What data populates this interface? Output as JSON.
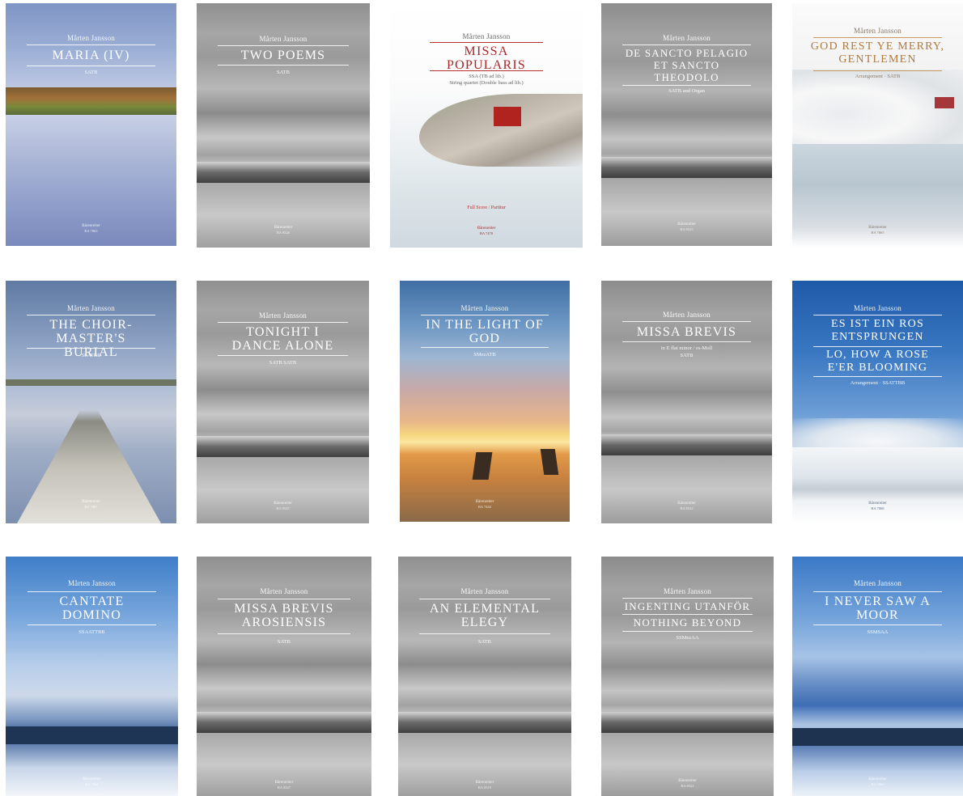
{
  "covers": [
    {
      "author": "Mårten Jansson",
      "title": "MARIA (IV)",
      "voicing": "SATB",
      "publisher": "Bärenreiter",
      "number": "BA 7863"
    },
    {
      "author": "Mårten Jansson",
      "title": "TWO POEMS",
      "voicing": "SATB",
      "publisher": "Bärenreiter",
      "number": "BA 8526"
    },
    {
      "author": "Mårten Jansson",
      "title": "MISSA POPULARIS",
      "voicing": "SSA (TB ad lib.)",
      "voicing2": "String quartet (Double bass ad lib.)",
      "edition": "Full Score / Partitur",
      "publisher": "Bärenreiter",
      "number": "BA 7470"
    },
    {
      "author": "Mårten Jansson",
      "title": "DE SANCTO PELAGIO ET SANCTO THEODOLO",
      "voicing": "SATB and Organ",
      "publisher": "Bärenreiter",
      "number": "BA 8523"
    },
    {
      "author": "Mårten Jansson",
      "title": "GOD REST YE MERRY, GENTLEMEN",
      "voicing": "Arrangement · SATB",
      "publisher": "Bärenreiter",
      "number": "BA 7865"
    },
    {
      "author": "Mårten Jansson",
      "title": "THE CHOIR-MASTER'S BURIAL",
      "voicing": "SSATBB",
      "publisher": "Bärenreiter",
      "number": "BA 7867"
    },
    {
      "author": "Mårten Jansson",
      "title": "TONIGHT I DANCE ALONE",
      "voicing": "SATB SATB",
      "publisher": "Bärenreiter",
      "number": "BA 8525"
    },
    {
      "author": "Mårten Jansson",
      "title": "IN THE LIGHT OF GOD",
      "voicing": "SMezATB",
      "publisher": "Bärenreiter",
      "number": "BA 7442"
    },
    {
      "author": "Mårten Jansson",
      "title": "MISSA BREVIS",
      "voicing": "in E flat minor / es-Moll",
      "voicing2": "SATB",
      "publisher": "Bärenreiter",
      "number": "BA 8522"
    },
    {
      "author": "Mårten Jansson",
      "title": "ES IST EIN ROS ENTSPRUNGEN",
      "title2": "LO, HOW A ROSE E'ER BLOOMING",
      "voicing": "Arrangement · SSATTBB",
      "publisher": "Bärenreiter",
      "number": "BA 7868"
    },
    {
      "author": "Mårten Jansson",
      "title": "CANTATE DOMINO",
      "voicing": "SSAATTBB",
      "publisher": "Bärenreiter",
      "number": "BA 7864"
    },
    {
      "author": "Mårten Jansson",
      "title": "MISSA BREVIS AROSIENSIS",
      "voicing": "SATB",
      "publisher": "Bärenreiter",
      "number": "BA 8527"
    },
    {
      "author": "Mårten Jansson",
      "title": "AN ELEMENTAL ELEGY",
      "voicing": "SATB",
      "publisher": "Bärenreiter",
      "number": "BA 8519"
    },
    {
      "author": "Mårten Jansson",
      "title": "INGENTING UTANFÖR",
      "title2": "NOTHING BEYOND",
      "voicing": "SSMezAA",
      "publisher": "Bärenreiter",
      "number": "BA 8522"
    },
    {
      "author": "Mårten Jansson",
      "title": "I NEVER SAW A MOOR",
      "voicing": "SSMSAA",
      "publisher": "Bärenreiter",
      "number": "BA 7866"
    }
  ]
}
